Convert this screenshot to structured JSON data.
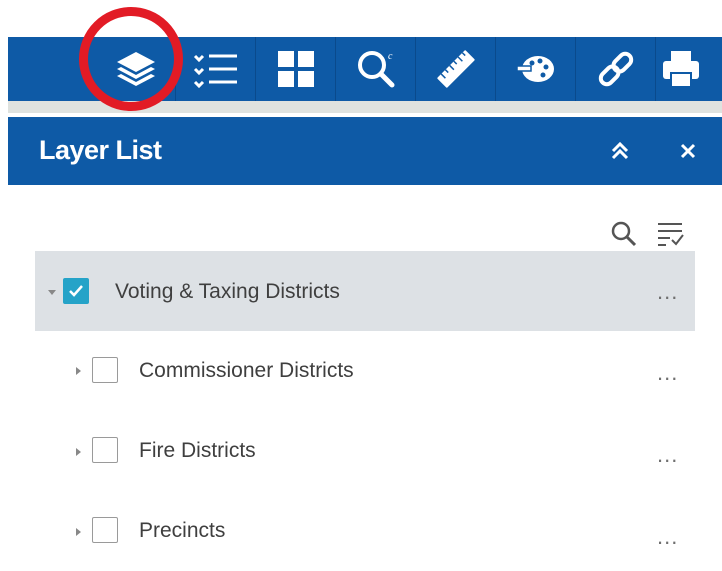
{
  "toolbar": {
    "tools": [
      {
        "icon": "layers-icon",
        "label": "Layer List"
      },
      {
        "icon": "legend-icon",
        "label": "Legend"
      },
      {
        "icon": "basemap-gallery-icon",
        "label": "Basemap Gallery"
      },
      {
        "icon": "search-icon",
        "label": "Search"
      },
      {
        "icon": "measurement-icon",
        "label": "Measurement"
      },
      {
        "icon": "draw-icon",
        "label": "Draw"
      },
      {
        "icon": "share-link-icon",
        "label": "Share"
      },
      {
        "icon": "print-icon",
        "label": "Print"
      }
    ]
  },
  "panel": {
    "title": "Layer List"
  },
  "layers": [
    {
      "label": "Voting & Taxing Districts",
      "checked": true,
      "expanded": true,
      "level": 0
    },
    {
      "label": "Commissioner Districts",
      "checked": false,
      "expanded": false,
      "level": 1
    },
    {
      "label": "Fire Districts",
      "checked": false,
      "expanded": false,
      "level": 1
    },
    {
      "label": "Precincts",
      "checked": false,
      "expanded": false,
      "level": 1
    }
  ],
  "more_label": "...",
  "colors": {
    "header_blue": "#0e5aa6",
    "highlight_ring": "#e21b25",
    "checkbox_checked": "#25a3c8",
    "group_row_bg": "#dde1e5"
  }
}
